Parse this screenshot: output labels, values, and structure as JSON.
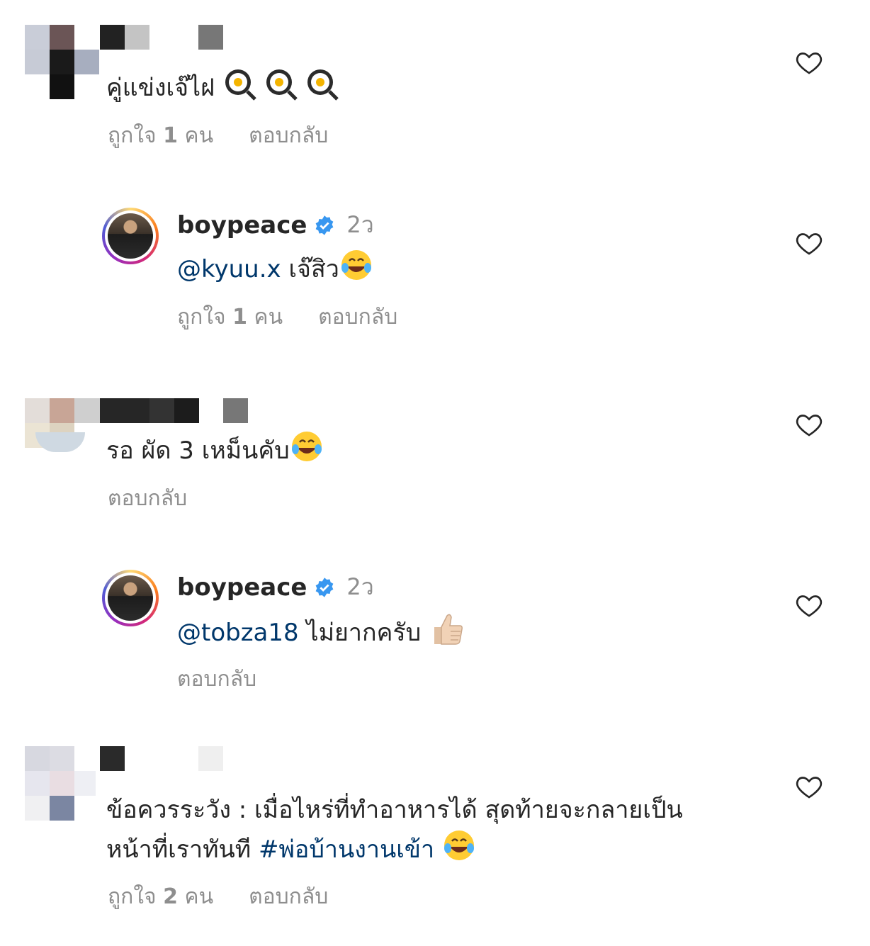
{
  "comments": [
    {
      "text": "คู่แข่งเจ๊ไฝ",
      "emoji": [
        "egg-frying-pan",
        "egg-frying-pan",
        "egg-frying-pan"
      ],
      "likes_prefix": "ถูกใจ",
      "likes_count": "1",
      "likes_suffix": "คน",
      "reply_label": "ตอบกลับ"
    },
    {
      "reply": true,
      "username": "boypeace",
      "time": "2ว",
      "mention": "@kyuu.x",
      "text": "เจ๊สิว",
      "emoji": [
        "tears-of-joy"
      ],
      "likes_prefix": "ถูกใจ",
      "likes_count": "1",
      "likes_suffix": "คน",
      "reply_label": "ตอบกลับ"
    },
    {
      "text": "รอ ผัด 3 เหม็นคับ",
      "emoji": [
        "tears-of-joy"
      ],
      "reply_label": "ตอบกลับ"
    },
    {
      "reply": true,
      "username": "boypeace",
      "time": "2ว",
      "mention": "@tobza18",
      "text": "ไม่ยากครับ",
      "emoji": [
        "thumbs-up"
      ],
      "reply_label": "ตอบกลับ"
    },
    {
      "text_line1": "ข้อควรระวัง : เมื่อไหร่ที่ทำอาหารได้ สุดท้ายจะกลายเป็น",
      "text_line2": "หน้าที่เราทันที",
      "hashtag": "#พ่อบ้านงานเข้า",
      "emoji": [
        "tears-of-joy"
      ],
      "likes_prefix": "ถูกใจ",
      "likes_count": "2",
      "likes_suffix": "คน",
      "reply_label": "ตอบกลับ"
    }
  ],
  "colors": {
    "text": "#262626",
    "secondary": "#8e8e8e",
    "link": "#00376b",
    "verified": "#3897f0"
  }
}
